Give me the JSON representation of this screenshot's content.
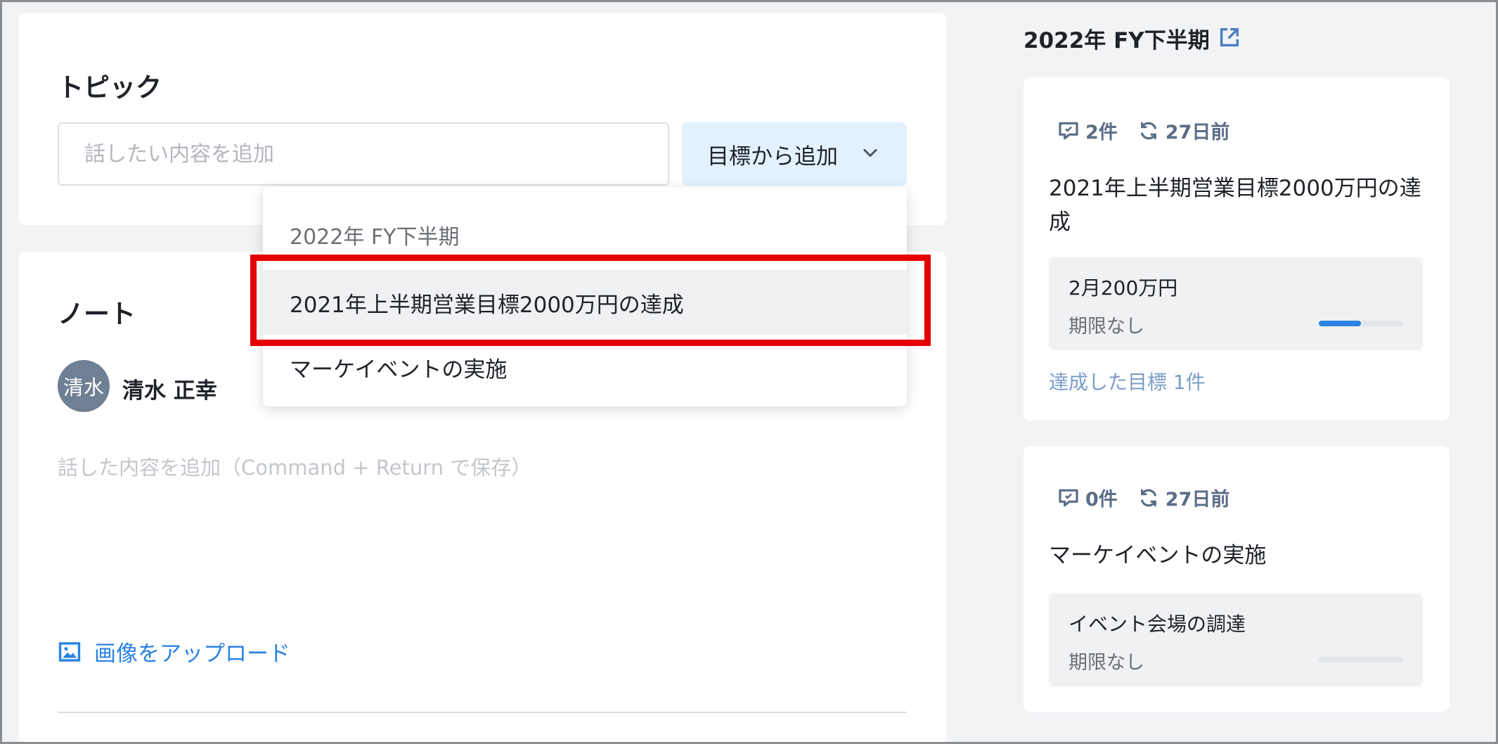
{
  "topic": {
    "title": "トピック",
    "input_placeholder": "話したい内容を追加",
    "add_from_goal_label": "目標から追加"
  },
  "dropdown": {
    "group_label": "2022年 FY下半期",
    "items": [
      {
        "label": "2021年上半期営業目標2000万円の達成"
      },
      {
        "label": "マーケイベントの実施"
      }
    ]
  },
  "note": {
    "title": "ノート",
    "avatar_initials": "清水",
    "author_name": "清水 正幸",
    "placeholder": "話した内容を追加（Command + Return で保存）",
    "upload_label": "画像をアップロード"
  },
  "side_panel": {
    "period_title": "2022年 FY下半期",
    "goals": [
      {
        "comment_count": "2件",
        "updated": "27日前",
        "title": "2021年上半期営業目標2000万円の達成",
        "key_result": {
          "title": "2月200万円",
          "deadline": "期限なし",
          "progress": 0.5
        },
        "achieved": "達成した目標 1件"
      },
      {
        "comment_count": "0件",
        "updated": "27日前",
        "title": "マーケイベントの実施",
        "key_result": {
          "title": "イベント会場の調達",
          "deadline": "期限なし",
          "progress": 0
        }
      }
    ]
  },
  "colors": {
    "accent_blue": "#2a82e4",
    "highlight_red": "#e60000",
    "meta_slate": "#5b6d87"
  },
  "icons": {
    "comment": "comment-icon",
    "refresh": "refresh-icon",
    "external_link": "external-link-icon",
    "image": "image-icon",
    "chevron": "chevron-down-icon"
  }
}
